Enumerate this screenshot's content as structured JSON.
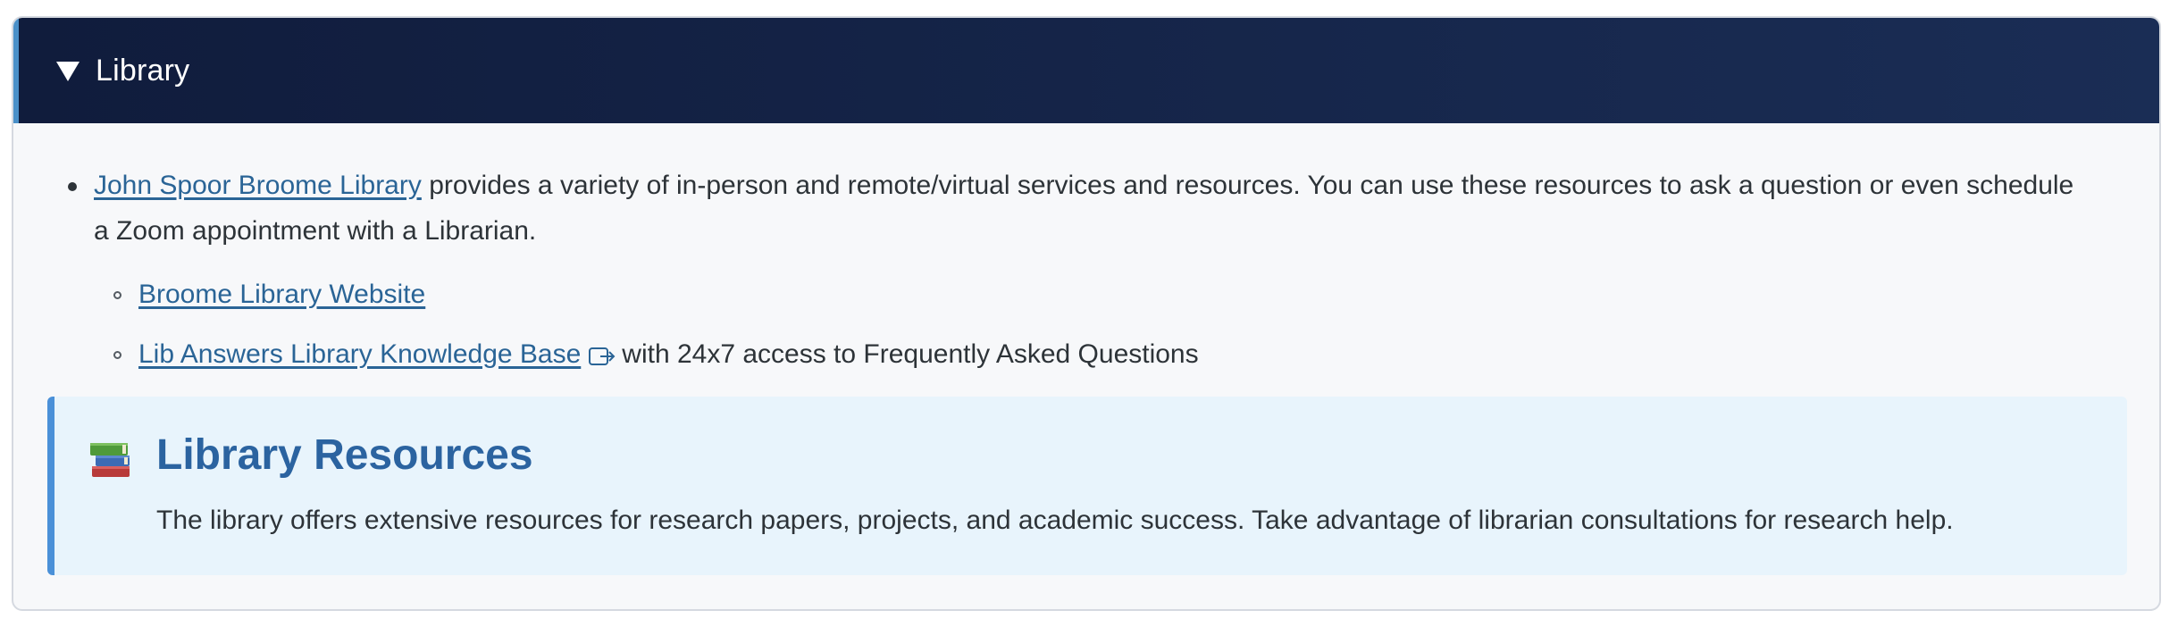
{
  "accordion": {
    "title": "Library",
    "expanded_icon": "triangle-down-icon"
  },
  "main_item": {
    "link_text": "John Spoor Broome Library",
    "text": " provides a variety of in-person and remote/virtual services and resources. You can use these resources to ask a question or even schedule a Zoom appointment with a Librarian."
  },
  "sub_items": [
    {
      "link_text": "Broome Library Website",
      "text": ""
    },
    {
      "link_text": "Lib Answers Library Knowledge Base",
      "icon": "external-link-icon",
      "text": "with 24x7 access to Frequently Asked Questions"
    }
  ],
  "callout": {
    "icon": "books-icon",
    "title": "Library Resources",
    "text": "The library offers extensive resources for research papers, projects, and academic success. Take advantage of librarian consultations for research help."
  },
  "colors": {
    "header_bg": "#101c3c",
    "link": "#2a6496",
    "callout_bg": "#e8f4fc",
    "callout_border": "#4a90d8",
    "callout_title": "#2b63a0"
  }
}
